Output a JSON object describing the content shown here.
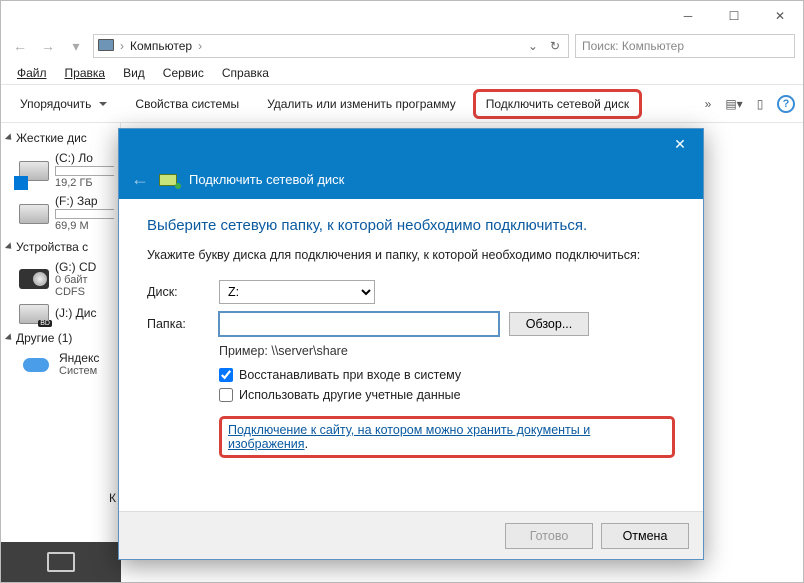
{
  "main": {
    "breadcrumb_label": "Компьютер",
    "search_placeholder": "Поиск: Компьютер"
  },
  "menubar": {
    "file": "Файл",
    "edit": "Правка",
    "view": "Вид",
    "tools": "Сервис",
    "help": "Справка"
  },
  "toolbar": {
    "organize": "Упорядочить",
    "sys_props": "Свойства системы",
    "uninstall": "Удалить или изменить программу",
    "map_drive": "Подключить сетевой диск",
    "chevron": "»"
  },
  "tree": {
    "group_hdd": "Жесткие дис",
    "drive_c_label": "(C:) Ло",
    "drive_c_sub": "19,2 ГБ",
    "drive_f_label": "(F:) Зар",
    "drive_f_sub": "69,9 М",
    "group_dev": "Устройства с",
    "drive_g_label": "(G:) CD",
    "drive_g_sub1": "0 байт",
    "drive_g_sub2": "CDFS",
    "drive_j_label": "(J:) Дис",
    "group_other": "Другие (1)",
    "yadisk_label": "Яндекс",
    "yadisk_sub": "Систем",
    "stray": "К"
  },
  "dialog": {
    "title": "Подключить сетевой диск",
    "heading": "Выберите сетевую папку, к которой необходимо подключиться.",
    "instruction": "Укажите букву диска для подключения и папку, к которой необходимо подключиться:",
    "drive_label": "Диск:",
    "drive_value": "Z:",
    "folder_label": "Папка:",
    "folder_value": "",
    "browse": "Обзор...",
    "example": "Пример: \\\\server\\share",
    "chk_reconnect": "Восстанавливать при входе в систему",
    "chk_other_creds": "Использовать другие учетные данные",
    "link": "Подключение к сайту, на котором можно хранить документы и изображения",
    "finish": "Готово",
    "cancel": "Отмена"
  }
}
